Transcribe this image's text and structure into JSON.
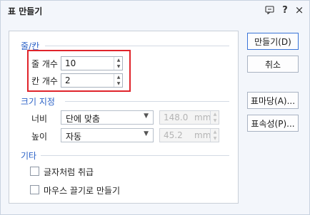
{
  "dialog": {
    "title": "표 만들기",
    "help_label": "?",
    "close_label": "×",
    "chat_icon": "chat-icon"
  },
  "rows_cols": {
    "section_label": "줄/칸",
    "rows_label": "줄 개수",
    "rows_value": "10",
    "cols_label": "칸 개수",
    "cols_value": "2",
    "highlight_color": "#e0242b"
  },
  "size": {
    "section_label": "크기 지정",
    "width_label": "너비",
    "width_mode": "단에 맞춤",
    "width_value": "148.0",
    "width_unit": "mm",
    "height_label": "높이",
    "height_mode": "자동",
    "height_value": "45.2",
    "height_unit": "mm"
  },
  "other": {
    "section_label": "기타",
    "treat_as_char_label": "글자처럼 취급",
    "treat_as_char_checked": false,
    "mouse_drag_label": "마우스 끌기로 만들기",
    "mouse_drag_checked": false
  },
  "buttons": {
    "create": "만들기(D)",
    "cancel": "취소",
    "table_style": "표마당(A)...",
    "table_props": "표속성(P)..."
  },
  "colors": {
    "section_label": "#2b62c7",
    "primary_border": "#3a74d8"
  }
}
